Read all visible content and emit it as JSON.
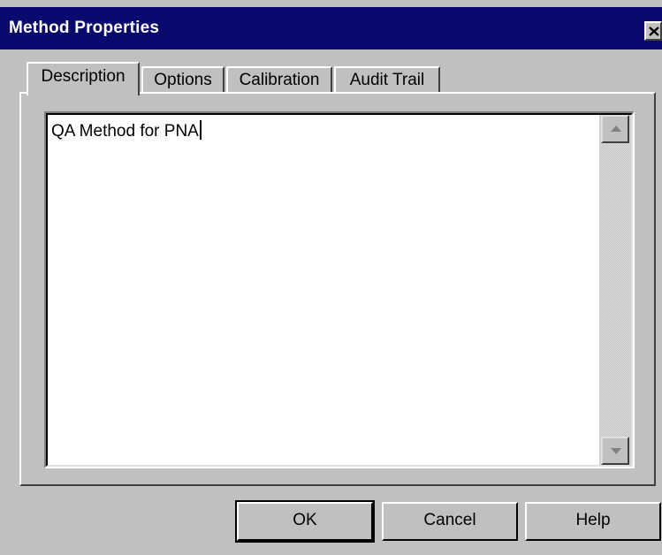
{
  "window": {
    "title": "Method Properties",
    "close_icon": "close-icon"
  },
  "tabs": [
    {
      "label": "Description",
      "active": true
    },
    {
      "label": "Options",
      "active": false
    },
    {
      "label": "Calibration",
      "active": false
    },
    {
      "label": "Audit Trail",
      "active": false
    }
  ],
  "description": {
    "value": "QA Method for PNA"
  },
  "buttons": {
    "ok": "OK",
    "cancel": "Cancel",
    "help": "Help"
  },
  "colors": {
    "titlebar": "#0a0a6e",
    "face": "#c0c0c0"
  }
}
